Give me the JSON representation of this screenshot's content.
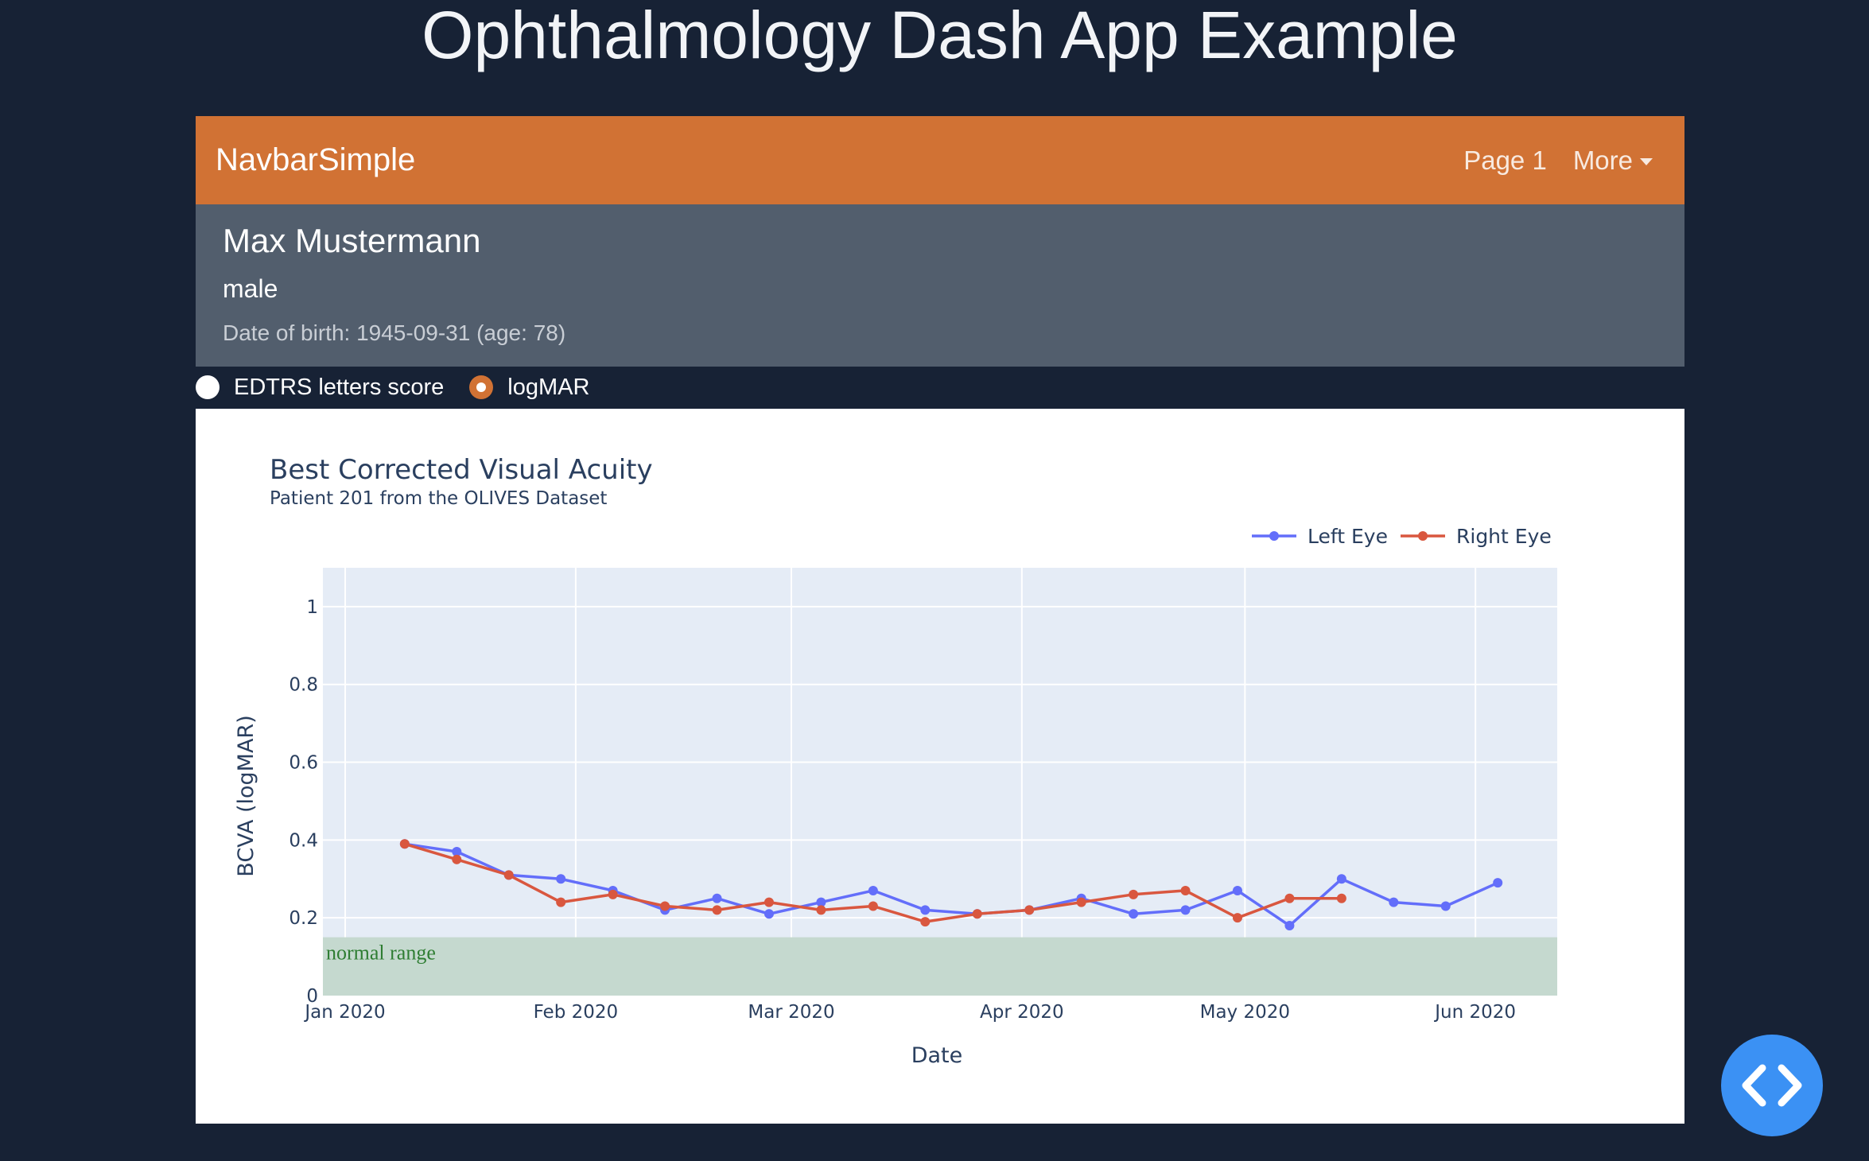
{
  "page": {
    "title": "Ophthalmology Dash App Example"
  },
  "navbar": {
    "brand": "NavbarSimple",
    "links": [
      {
        "label": "Page 1"
      },
      {
        "label": "More"
      }
    ]
  },
  "patient": {
    "name": "Max Mustermann",
    "sex": "male",
    "dob": "Date of birth: 1945-09-31 (age: 78)"
  },
  "radios": {
    "options": [
      {
        "label": "EDTRS letters score",
        "checked": false
      },
      {
        "label": "logMAR",
        "checked": true
      }
    ]
  },
  "colors": {
    "background": "#172235",
    "navbar": "#d17234",
    "patient_panel": "#525e6d",
    "left_eye": "#636efa",
    "right_eye": "#d9573f",
    "normal_band": "#c5d9cf",
    "plot_bg": "#e5ecf6",
    "fab": "#3b91f4"
  },
  "fab": {
    "icon": "code-brackets-icon"
  },
  "chart_data": {
    "type": "line",
    "title": "Best Corrected Visual Acuity",
    "subtitle": "Patient 201 from the OLIVES Dataset",
    "xlabel": "Date",
    "ylabel": "BCVA (logMAR)",
    "ylim": [
      0,
      1.1
    ],
    "yticks": [
      "0",
      "0.2",
      "0.4",
      "0.6",
      "0.8",
      "1"
    ],
    "xticks": [
      {
        "date": "2020-01-01",
        "label": "Jan 2020"
      },
      {
        "date": "2020-02-01",
        "label": "Feb 2020"
      },
      {
        "date": "2020-03-01",
        "label": "Mar 2020"
      },
      {
        "date": "2020-04-01",
        "label": "Apr 2020"
      },
      {
        "date": "2020-05-01",
        "label": "May 2020"
      },
      {
        "date": "2020-06-01",
        "label": "Jun 2020"
      }
    ],
    "xlim": [
      "2019-12-29",
      "2020-06-12"
    ],
    "grid": true,
    "legend": "top-right",
    "annotation": {
      "text": "normal range",
      "y_range": [
        0,
        0.15
      ]
    },
    "series": [
      {
        "name": "Left Eye",
        "x": [
          "2020-01-09",
          "2020-01-16",
          "2020-01-23",
          "2020-01-30",
          "2020-02-06",
          "2020-02-13",
          "2020-02-20",
          "2020-02-27",
          "2020-03-05",
          "2020-03-12",
          "2020-03-19",
          "2020-03-26",
          "2020-04-02",
          "2020-04-09",
          "2020-04-16",
          "2020-04-23",
          "2020-04-30",
          "2020-05-07",
          "2020-05-14",
          "2020-05-21",
          "2020-05-28",
          "2020-06-04"
        ],
        "y": [
          0.39,
          0.37,
          0.31,
          0.3,
          0.27,
          0.22,
          0.25,
          0.21,
          0.24,
          0.27,
          0.22,
          0.21,
          0.22,
          0.25,
          0.21,
          0.22,
          0.27,
          0.18,
          0.3,
          0.24,
          0.23,
          0.29
        ]
      },
      {
        "name": "Right Eye",
        "x": [
          "2020-01-09",
          "2020-01-16",
          "2020-01-23",
          "2020-01-30",
          "2020-02-06",
          "2020-02-13",
          "2020-02-20",
          "2020-02-27",
          "2020-03-05",
          "2020-03-12",
          "2020-03-19",
          "2020-03-26",
          "2020-04-02",
          "2020-04-09",
          "2020-04-16",
          "2020-04-23",
          "2020-04-30",
          "2020-05-07",
          "2020-05-14"
        ],
        "y": [
          0.39,
          0.35,
          0.31,
          0.24,
          0.26,
          0.23,
          0.22,
          0.24,
          0.22,
          0.23,
          0.19,
          0.21,
          0.22,
          0.24,
          0.26,
          0.27,
          0.2,
          0.25,
          0.25
        ]
      }
    ]
  }
}
